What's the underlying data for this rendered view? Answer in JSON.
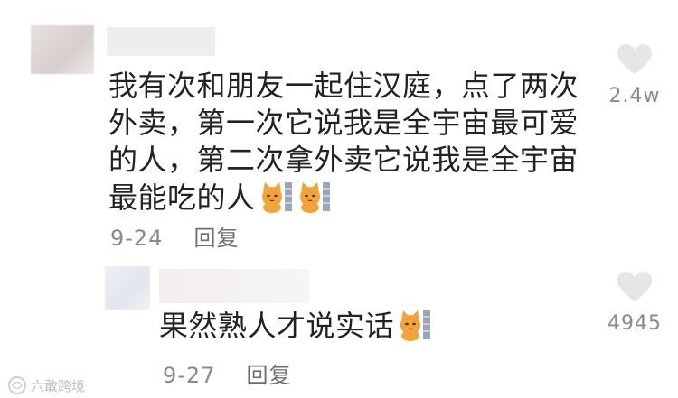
{
  "comments": {
    "main": {
      "text": "我有次和朋友一起住汉庭，点了两次外卖，第一次它说我是全宇宙最可爱的人，第二次拿外卖它说我是全宇宙最能吃的人",
      "emoji": [
        "cat-emoji",
        "cat-emoji"
      ],
      "date": "9-24",
      "reply_label": "回复",
      "likes": "2.4w"
    },
    "reply": {
      "text": "果然熟人才说实话",
      "emoji": [
        "cat-emoji"
      ],
      "date": "9-27",
      "reply_label": "回复",
      "likes": "4945"
    }
  },
  "watermark": {
    "text": "六敢跨境"
  },
  "colors": {
    "text": "#222222",
    "meta": "#8a8a8a",
    "heart": "#e6e6e6",
    "cat": "#f2a33a"
  }
}
